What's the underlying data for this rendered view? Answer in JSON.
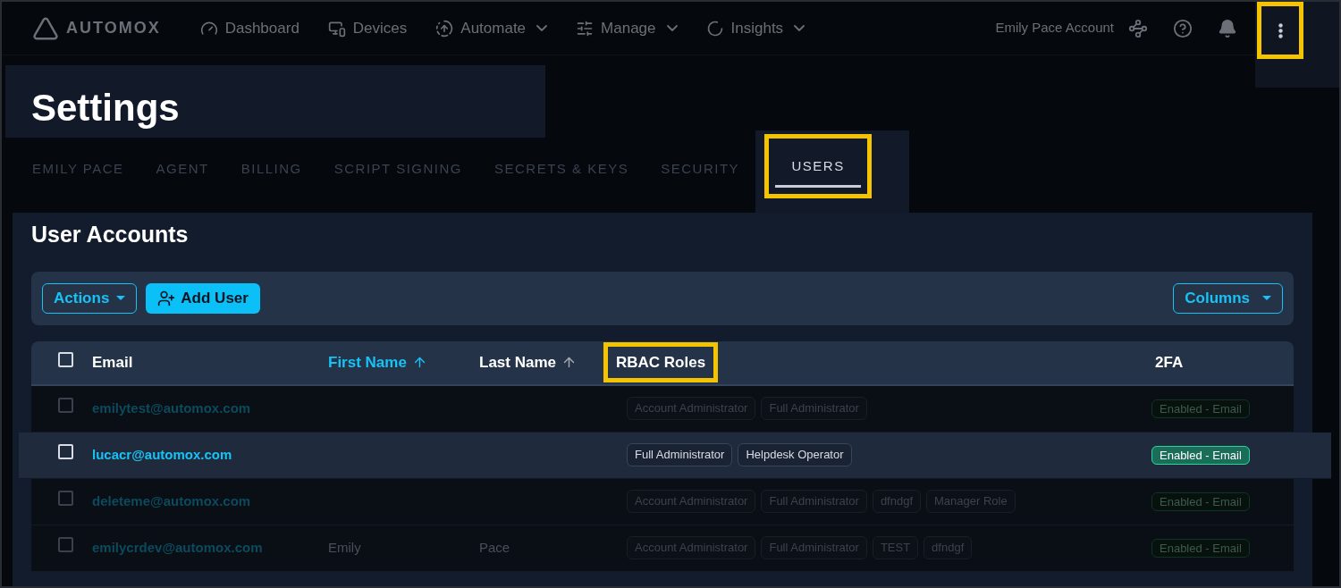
{
  "nav": {
    "brand": "AUTOMOX",
    "items": [
      {
        "kind": "dashboard",
        "label": "Dashboard",
        "dropdown": false
      },
      {
        "kind": "devices",
        "label": "Devices",
        "dropdown": false
      },
      {
        "kind": "automate",
        "label": "Automate",
        "dropdown": true
      },
      {
        "kind": "manage",
        "label": "Manage",
        "dropdown": true
      },
      {
        "kind": "insights",
        "label": "Insights",
        "dropdown": true
      }
    ],
    "account": "Emily Pace Account",
    "menu_highlighted": true
  },
  "page_title": "Settings",
  "tabs": [
    {
      "label": "EMILY PACE",
      "selected": false,
      "highlighted": false
    },
    {
      "label": "AGENT",
      "selected": false,
      "highlighted": false
    },
    {
      "label": "BILLING",
      "selected": false,
      "highlighted": false
    },
    {
      "label": "SCRIPT SIGNING",
      "selected": false,
      "highlighted": false
    },
    {
      "label": "SECRETS & KEYS",
      "selected": false,
      "highlighted": false
    },
    {
      "label": "SECURITY",
      "selected": false,
      "highlighted": false
    },
    {
      "label": "USERS",
      "selected": true,
      "highlighted": true
    }
  ],
  "section_title": "User Accounts",
  "toolbar": {
    "actions": "Actions",
    "add_user": "Add User",
    "columns": "Columns"
  },
  "table": {
    "columns": [
      {
        "label": "Email",
        "sortable": false,
        "active": false,
        "highlighted": false
      },
      {
        "label": "First Name",
        "sortable": true,
        "active": true,
        "highlighted": false
      },
      {
        "label": "Last Name",
        "sortable": true,
        "active": false,
        "highlighted": false
      },
      {
        "label": "RBAC Roles",
        "sortable": false,
        "active": false,
        "highlighted": true
      },
      {
        "label": "2FA",
        "sortable": false,
        "active": false,
        "highlighted": false
      }
    ],
    "header_checked": false,
    "rows": [
      {
        "email": "emilytest@automox.com",
        "first": "",
        "last": "",
        "roles": [
          "Account Administrator",
          "Full Administrator"
        ],
        "twofa": "Enabled - Email",
        "checked": false,
        "dimmed": true
      },
      {
        "email": "lucacr@automox.com",
        "first": "",
        "last": "",
        "roles": [
          "Full Administrator",
          "Helpdesk Operator"
        ],
        "twofa": "Enabled - Email",
        "checked": false,
        "dimmed": false
      },
      {
        "email": "deleteme@automox.com",
        "first": "",
        "last": "",
        "roles": [
          "Account Administrator",
          "Full Administrator",
          "dfndgf",
          "Manager Role"
        ],
        "twofa": "Enabled - Email",
        "checked": false,
        "dimmed": true
      },
      {
        "email": "emilycrdev@automox.com",
        "first": "Emily",
        "last": "Pace",
        "roles": [
          "Account Administrator",
          "Full Administrator",
          "TEST",
          "dfndgf"
        ],
        "twofa": "Enabled - Email",
        "checked": false,
        "dimmed": true
      }
    ]
  }
}
